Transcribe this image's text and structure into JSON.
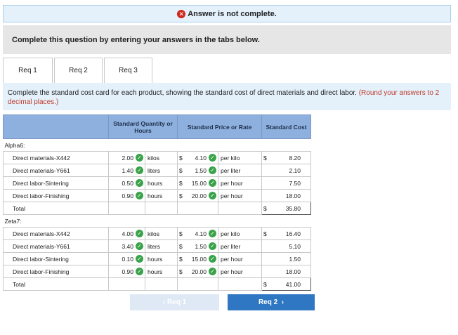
{
  "banner": {
    "text": "Answer is not complete."
  },
  "prompt": "Complete this question by entering your answers in the tabs below.",
  "tabs": [
    "Req 1",
    "Req 2",
    "Req 3"
  ],
  "instructions": {
    "text": "Complete the standard cost card for each product, showing the standard cost of direct materials and direct labor.",
    "note": "(Round your answers to 2 decimal places.)"
  },
  "table": {
    "headers": {
      "qty": "Standard Quantity or Hours",
      "price": "Standard Price or Rate",
      "cost": "Standard Cost"
    },
    "sections": [
      {
        "name": "Alpha6:",
        "rows": [
          {
            "label": "Direct materials-X442",
            "qty": "2.00",
            "unit": "kilos",
            "cur": "$",
            "price": "4.10",
            "rate_unit": "per kilo",
            "cost_cur": "$",
            "cost": "8.20"
          },
          {
            "label": "Direct materials-Y661",
            "qty": "1.40",
            "unit": "liters",
            "cur": "$",
            "price": "1.50",
            "rate_unit": "per liter",
            "cost_cur": "",
            "cost": "2.10"
          },
          {
            "label": "Direct labor-Sintering",
            "qty": "0.50",
            "unit": "hours",
            "cur": "$",
            "price": "15.00",
            "rate_unit": "per hour",
            "cost_cur": "",
            "cost": "7.50"
          },
          {
            "label": "Direct labor-Finishing",
            "qty": "0.90",
            "unit": "hours",
            "cur": "$",
            "price": "20.00",
            "rate_unit": "per hour",
            "cost_cur": "",
            "cost": "18.00"
          }
        ],
        "total_label": "Total",
        "total_cur": "$",
        "total": "35.80"
      },
      {
        "name": "Zeta7:",
        "rows": [
          {
            "label": "Direct materials-X442",
            "qty": "4.00",
            "unit": "kilos",
            "cur": "$",
            "price": "4.10",
            "rate_unit": "per kilo",
            "cost_cur": "$",
            "cost": "16.40"
          },
          {
            "label": "Direct materials-Y661",
            "qty": "3.40",
            "unit": "liters",
            "cur": "$",
            "price": "1.50",
            "rate_unit": "per liter",
            "cost_cur": "",
            "cost": "5.10"
          },
          {
            "label": "Direct labor-Sintering",
            "qty": "0.10",
            "unit": "hours",
            "cur": "$",
            "price": "15.00",
            "rate_unit": "per hour",
            "cost_cur": "",
            "cost": "1.50"
          },
          {
            "label": "Direct labor-Finishing",
            "qty": "0.90",
            "unit": "hours",
            "cur": "$",
            "price": "20.00",
            "rate_unit": "per hour",
            "cost_cur": "",
            "cost": "18.00"
          }
        ],
        "total_label": "Total",
        "total_cur": "$",
        "total": "41.00"
      }
    ]
  },
  "nav": {
    "prev": "Req 1",
    "next": "Req 2"
  },
  "colors": {
    "header_bg": "#8db0de",
    "check": "#3aa34a",
    "next_btn": "#2f77c2",
    "error": "#d0271d"
  }
}
